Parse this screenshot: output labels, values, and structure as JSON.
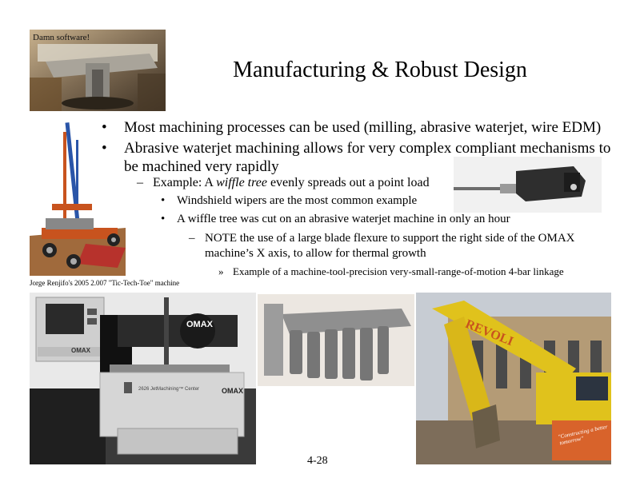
{
  "slide": {
    "title": "Manufacturing & Robust Design",
    "page_number": "4-28",
    "top_left_overlay": "Damn software!",
    "caption": "Jorge Renjifo's 2005 2.007 \"Tic-Tech-Toe\" machine",
    "bullets": [
      {
        "level": 1,
        "marker": "•",
        "text": "Most machining processes can be used (milling, abrasive waterjet, wire EDM)"
      },
      {
        "level": 1,
        "marker": "•",
        "line1": "Abrasive waterjet machining allows for very complex compliant mechanisms to",
        "line2": "be machined very rapidly"
      },
      {
        "level": 2,
        "marker": "–",
        "pre": "Example:  A ",
        "italic": "wiffle tree",
        "post": " evenly spreads out a point load"
      },
      {
        "level": 3,
        "marker": "•",
        "text": "Windshield wipers are the most common example"
      },
      {
        "level": 3,
        "marker": "•",
        "text": "A wiffle tree was cut on an abrasive waterjet machine in only an hour"
      },
      {
        "level": 4,
        "marker": "–",
        "line1": "NOTE the use of a large blade flexure to support the right side of the OMAX",
        "line2": "machine’s X axis, to allow for thermal growth"
      },
      {
        "level": 5,
        "marker": "»",
        "text": "Example of a machine-tool-precision very-small-range-of-motion 4-bar linkage"
      }
    ],
    "photo_labels": {
      "omax_head": "OMAX",
      "omax_base": "OMAX",
      "omax_panel": "OMAX",
      "omax_center": "2626 JetMachining™ Center",
      "excavator_brand": "REVOLI",
      "excavator_tagline": "\"Constructing a better tomorrow\""
    },
    "colors": {
      "text": "#000000",
      "background": "#ffffff",
      "excavator_yellow": "#e0c21c",
      "omax_orange": "#d8632b"
    }
  }
}
